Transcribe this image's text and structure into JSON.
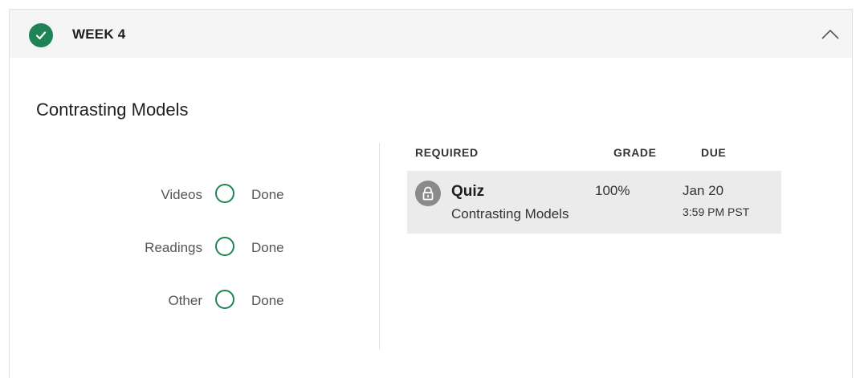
{
  "week": {
    "title": "WEEK 4",
    "completed": true,
    "accent_color": "#1f8354"
  },
  "module": {
    "title": "Contrasting Models"
  },
  "progress": [
    {
      "label": "Videos",
      "status": "Done"
    },
    {
      "label": "Readings",
      "status": "Done"
    },
    {
      "label": "Other",
      "status": "Done"
    }
  ],
  "table": {
    "headers": {
      "required": "REQUIRED",
      "grade": "GRADE",
      "due": "DUE"
    },
    "rows": [
      {
        "icon": "lock-icon",
        "name": "Quiz",
        "subtitle": "Contrasting Models",
        "grade": "100%",
        "due_date": "Jan 20",
        "due_time": "3:59 PM PST"
      }
    ]
  },
  "icons": {
    "header_status": "check-circle-icon",
    "collapse": "chevron-up-icon",
    "progress_item": "circle-outline-icon"
  }
}
